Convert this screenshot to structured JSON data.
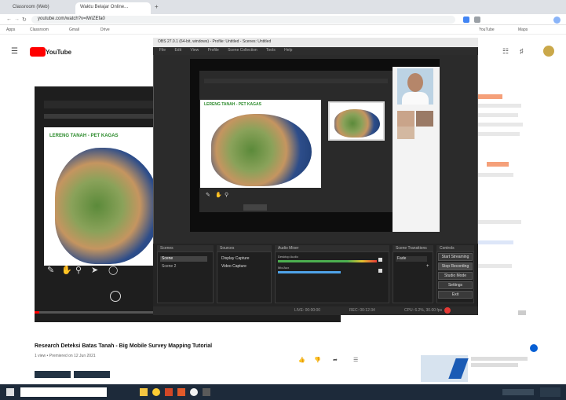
{
  "browser": {
    "tabs": [
      {
        "label": "Classroom (Web)"
      },
      {
        "label": "Waktu Belajar Online..."
      }
    ],
    "new_tab_label": "+",
    "address": "youtube.com/watch?v=lWiZEfa0",
    "bookmarks": [
      "Apps",
      "Classroom",
      "Gmail",
      "Drive",
      "YouTube",
      "Maps"
    ]
  },
  "youtube": {
    "logo_text": "YouTube",
    "video_title": "Research Deteksi Batas Tanah - Big Mobile Survey Mapping Tutorial",
    "video_meta": "1 view • Premiered on 12 Jun 2021"
  },
  "obs": {
    "window_title": "OBS 27.0.1 (64-bit, windows) - Profile: Untitled - Scenes: Untitled",
    "menu": [
      "File",
      "Edit",
      "View",
      "Profile",
      "Scene Collection",
      "Tools",
      "Help"
    ],
    "slide_title": "LERENG TANAH - PET KAGAS",
    "docks": [
      {
        "title": "Scenes",
        "items": [
          "Scene",
          "Scene 2"
        ]
      },
      {
        "title": "Sources",
        "items": [
          "Display Capture",
          "Video Capture"
        ]
      },
      {
        "title": "Audio Mixer",
        "items": [
          "Desktop Audio",
          "Mic/Aux"
        ]
      },
      {
        "title": "Scene Transitions",
        "items": [
          "Fade"
        ]
      },
      {
        "title": "Controls",
        "items": []
      }
    ],
    "controls": [
      "Start Streaming",
      "Stop Recording",
      "Studio Mode",
      "Settings",
      "Exit"
    ],
    "status": [
      "LIVE: 00:00:00",
      "REC: 00:12:34",
      "CPU: 6.2%, 30.00 fps"
    ]
  },
  "colors": {
    "youtube_red": "#ff0000",
    "obs_bg": "#2b2b2b",
    "rec_red": "#e53935"
  }
}
